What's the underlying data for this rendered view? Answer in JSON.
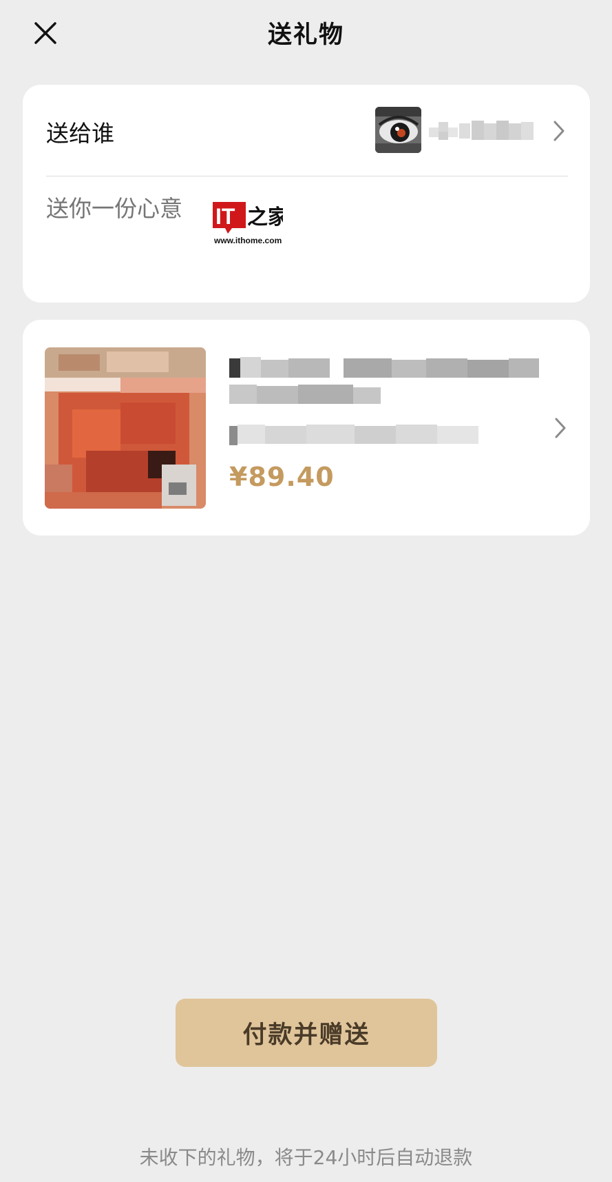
{
  "header": {
    "title": "送礼物",
    "close_icon": "close-icon"
  },
  "recipient": {
    "label": "送给谁",
    "chevron_icon": "chevron-right-icon"
  },
  "message": {
    "placeholder": "送你一份心意"
  },
  "watermark": {
    "logo_text": "IT之家",
    "url": "www.ithome.com"
  },
  "product": {
    "price": "¥89.40",
    "chevron_icon": "chevron-right-icon"
  },
  "actions": {
    "pay_label": "付款并赠送"
  },
  "footer": {
    "note": "未收下的礼物，将于24小时后自动退款"
  },
  "colors": {
    "background": "#ededed",
    "card": "#ffffff",
    "accent_price": "#c49a5f",
    "button": "#e0c59b",
    "button_text": "#4a3b28"
  }
}
